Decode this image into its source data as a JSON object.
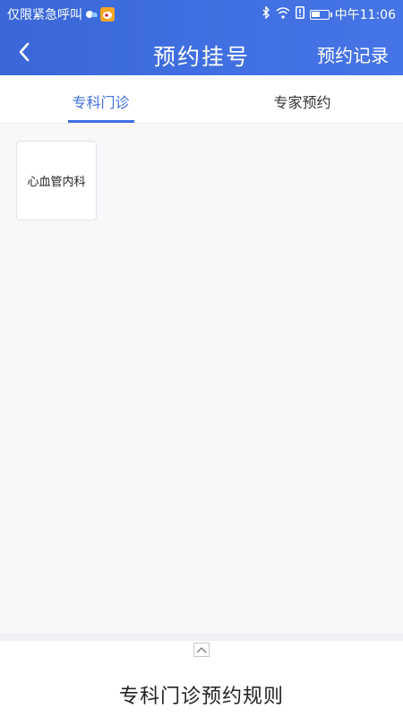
{
  "status_bar": {
    "notice": "仅限紧急呼叫",
    "time": "中午11:06",
    "icons": [
      "weather-icon",
      "weibo-icon",
      "bluetooth-icon",
      "wifi-icon",
      "alert-icon",
      "battery-icon"
    ]
  },
  "nav": {
    "back_icon": "chevron-left-icon",
    "title": "预约挂号",
    "right_label": "预约记录"
  },
  "tabs": [
    {
      "label": "专科门诊",
      "active": true
    },
    {
      "label": "专家预约",
      "active": false
    }
  ],
  "departments": [
    {
      "label": "心血管内科"
    }
  ],
  "rules": {
    "expand_icon": "chevron-up-icon",
    "title": "专科门诊预约规则"
  },
  "colors": {
    "accent": "#3f6fe0",
    "header_gradient_start": "#3a67d8",
    "header_gradient_end": "#4574e6",
    "text": "#222222",
    "background": "#f8f8fa"
  }
}
